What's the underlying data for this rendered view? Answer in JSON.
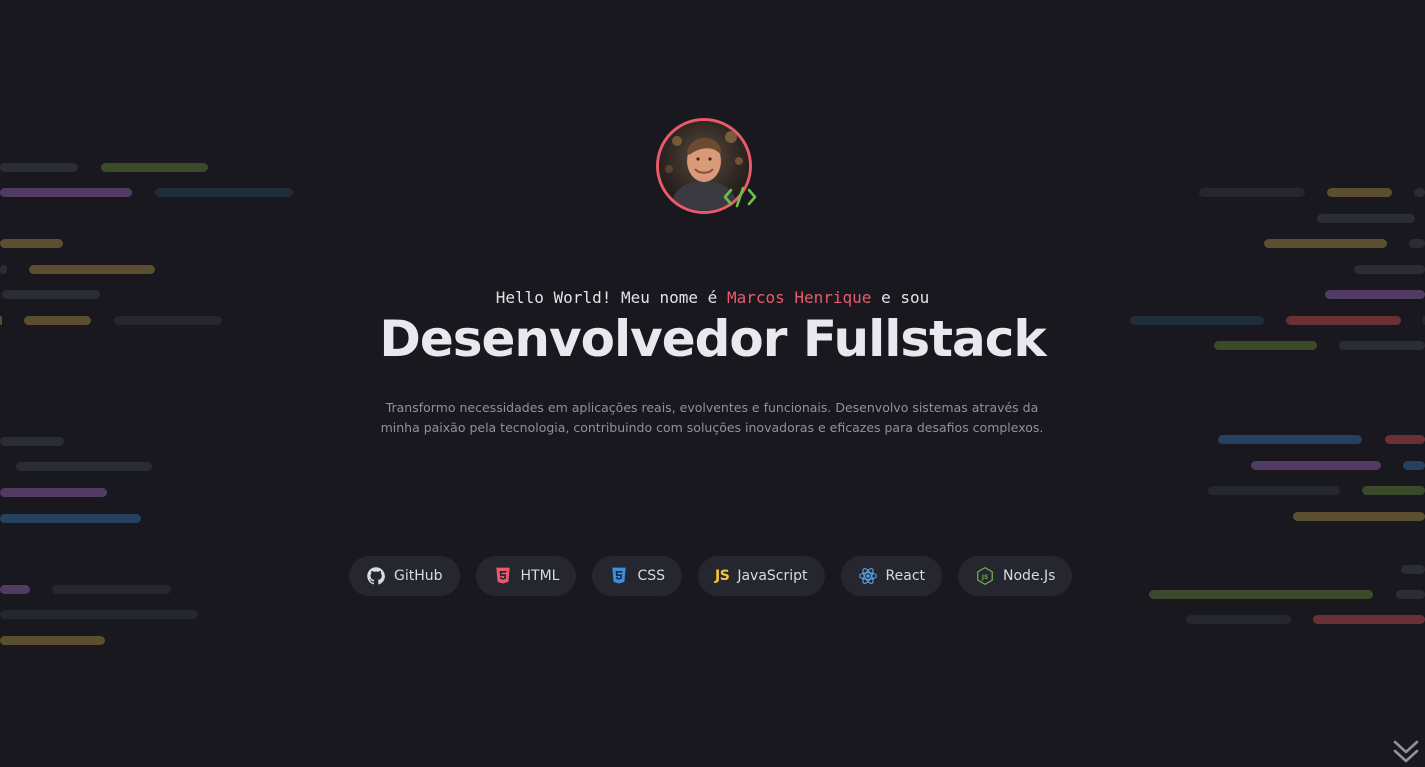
{
  "profile": {
    "greeting_prefix": "Hello World! Meu nome é ",
    "name": "Marcos Henrique",
    "greeting_suffix": " e sou",
    "title": "Desenvolvedor Fullstack",
    "description_line1": "Transformo necessidades em aplicações reais, evolventes e funcionais. Desenvolvo sistemas através da",
    "description_line2": "minha paixão pela tecnologia, contribuindo com soluções inovadoras e eficazes para desafios complexos."
  },
  "tags": [
    {
      "label": "GitHub",
      "icon": "github-icon",
      "color": "#d9dae2"
    },
    {
      "label": "HTML",
      "icon": "html5-icon",
      "color": "#e85a6c"
    },
    {
      "label": "CSS",
      "icon": "css3-icon",
      "color": "#3b8fe0"
    },
    {
      "label": "JavaScript",
      "icon": "javascript-icon",
      "color": "#f0c43b"
    },
    {
      "label": "React",
      "icon": "react-icon",
      "color": "#5aa8e8"
    },
    {
      "label": "Node.Js",
      "icon": "nodejs-icon",
      "color": "#6aa84f"
    }
  ],
  "colors": {
    "background": "#18181e",
    "accent": "#e85a6c",
    "code_badge": "#6cc04a"
  }
}
